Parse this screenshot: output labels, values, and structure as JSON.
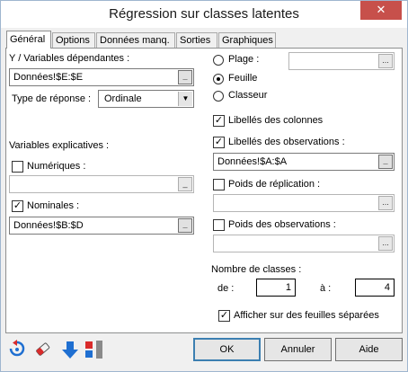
{
  "window": {
    "title": "Régression sur classes latentes",
    "close_glyph": "✕"
  },
  "tabs": [
    {
      "label": "Général",
      "active": true
    },
    {
      "label": "Options"
    },
    {
      "label": "Données manq."
    },
    {
      "label": "Sorties"
    },
    {
      "label": "Graphiques"
    }
  ],
  "general": {
    "y_label": "Y / Variables dépendantes :",
    "y_value": "Données!$E:$E",
    "response_type_label": "Type de réponse :",
    "response_type_value": "Ordinale",
    "explanatory_label": "Variables explicatives :",
    "numeric_label": "Numériques :",
    "numeric_checked": false,
    "numeric_value": "",
    "nominal_label": "Nominales :",
    "nominal_checked": true,
    "nominal_value": "Données!$B:$D"
  },
  "output": {
    "range_label": "Plage :",
    "sheet_label": "Feuille",
    "workbook_label": "Classeur",
    "selected": "Feuille",
    "range_value": ""
  },
  "options": {
    "col_labels_label": "Libellés des colonnes",
    "col_labels_checked": true,
    "obs_labels_label": "Libellés des observations :",
    "obs_labels_checked": true,
    "obs_labels_value": "Données!$A:$A",
    "rep_weights_label": "Poids de réplication :",
    "rep_weights_checked": false,
    "obs_weights_label": "Poids des observations :",
    "obs_weights_checked": false
  },
  "classes": {
    "label": "Nombre de classes :",
    "from_label": "de :",
    "from_value": "1",
    "to_label": "à :",
    "to_value": "4",
    "separate_sheets_label": "Afficher sur des feuilles séparées",
    "separate_sheets_checked": true
  },
  "footer": {
    "ok_label": "OK",
    "cancel_label": "Annuler",
    "help_label": "Aide"
  },
  "glyphs": {
    "checked": "✓",
    "ellipsis": "...",
    "ellipsis_dark": "_",
    "dropdown": "▼"
  },
  "colors": {
    "blue": "#1f6fd1",
    "red": "#d92b2b",
    "gray": "#8a8a8a"
  }
}
